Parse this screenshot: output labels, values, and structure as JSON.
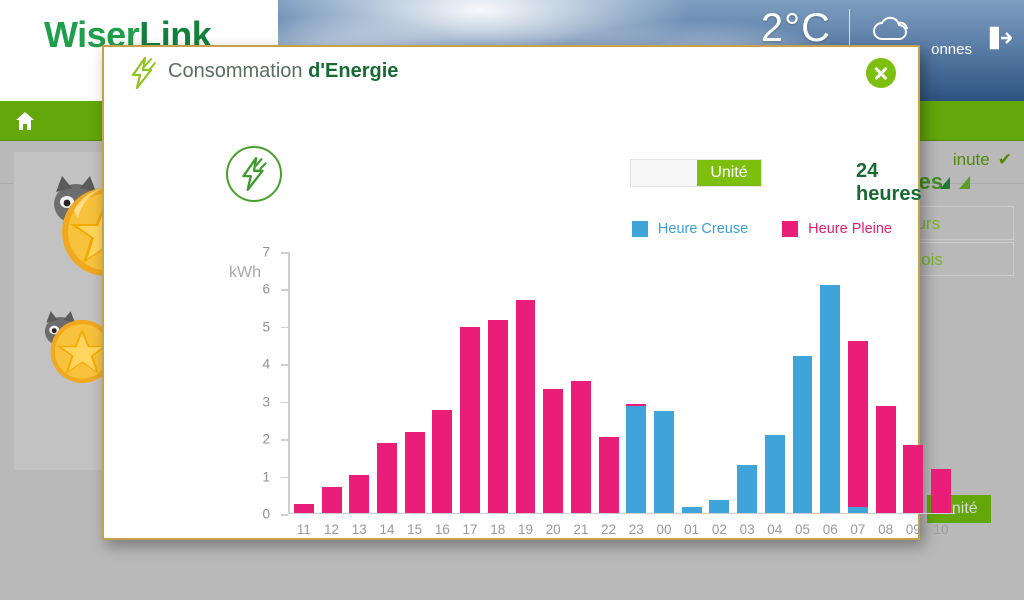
{
  "background": {
    "logo_first": "Wiser",
    "logo_second": "Link",
    "weather_temp": "2°C",
    "weather_icon": "cloud-icon",
    "user_label": "onnes",
    "logout_icon": "logout-icon",
    "home_icon": "home-icon",
    "minute_label": "inute",
    "minute_check": "✔",
    "heures_label": "ures",
    "dropdown_jours": "ours",
    "dropdown_mois": "mois",
    "unite_button": "Unité"
  },
  "modal": {
    "title_regular": "Consommation ",
    "title_bold": "d'Energie",
    "bolt_icon": "lightning-bolt-icon",
    "close_icon": "close-icon",
    "toggle_label": "Unité",
    "range_label": "24 heures",
    "range_caret": "triangle-caret-icon"
  },
  "legend": [
    {
      "label": "Heure Creuse",
      "color": "#3fa4da",
      "key": "creuse"
    },
    {
      "label": "Heure Pleine",
      "color": "#ea1e79",
      "key": "pleine"
    }
  ],
  "colors": {
    "creuse": "#3fa4da",
    "pleine": "#ea1e79",
    "accent_green": "#7cc00d",
    "brand_green": "#176b32",
    "modal_border": "#c5a24a"
  },
  "chart_data": {
    "type": "bar",
    "stacked": true,
    "title": "Consommation d'Energie",
    "xlabel": "",
    "ylabel": "kWh",
    "ylim": [
      0,
      7
    ],
    "yticks": [
      0,
      1,
      2,
      3,
      4,
      5,
      6,
      7
    ],
    "grid": false,
    "legend_position": "top-right",
    "categories": [
      "11",
      "12",
      "13",
      "14",
      "15",
      "16",
      "17",
      "18",
      "19",
      "20",
      "21",
      "22",
      "23",
      "00",
      "01",
      "02",
      "03",
      "04",
      "05",
      "06",
      "07",
      "08",
      "09",
      "10"
    ],
    "series": [
      {
        "name": "Heure Pleine",
        "color": "#ea1e79",
        "values": [
          0.22,
          0.67,
          1.01,
          1.87,
          2.16,
          2.74,
          4.95,
          5.14,
          5.67,
          3.3,
          3.51,
          2.03,
          0.06,
          0,
          0,
          0,
          0,
          0,
          0,
          0,
          4.43,
          2.84,
          1.8,
          1.17
        ]
      },
      {
        "name": "Heure Creuse",
        "color": "#3fa4da",
        "values": [
          0,
          0,
          0,
          0,
          0,
          0,
          0,
          0,
          0,
          0,
          0,
          0,
          2.85,
          2.71,
          0.14,
          0.34,
          1.26,
          2.07,
          4.17,
          6.08,
          0.15,
          0,
          0,
          0
        ]
      }
    ],
    "totals": [
      0.22,
      0.67,
      1.01,
      1.87,
      2.16,
      2.74,
      4.95,
      5.14,
      5.67,
      3.3,
      3.51,
      2.03,
      2.91,
      2.71,
      0.14,
      0.34,
      1.26,
      2.07,
      4.17,
      6.08,
      4.58,
      2.84,
      1.8,
      1.17
    ]
  }
}
